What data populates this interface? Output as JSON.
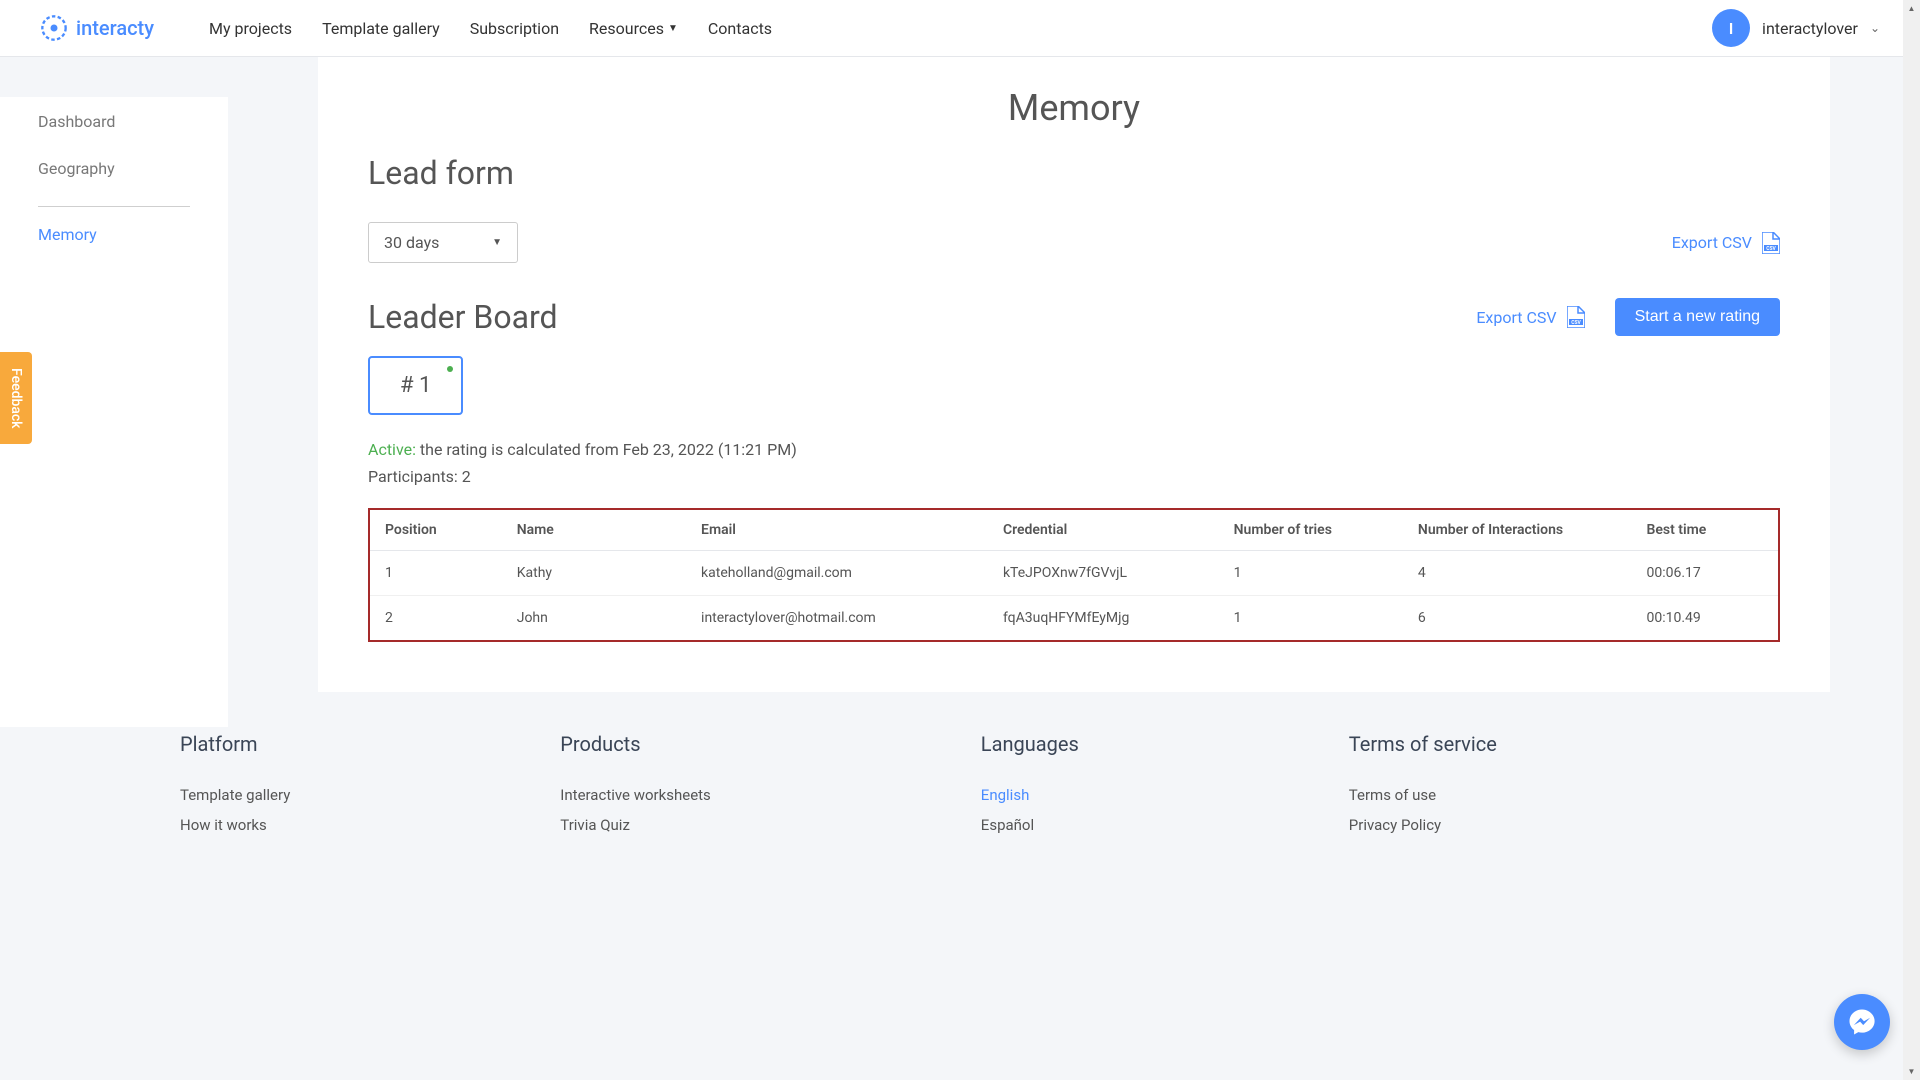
{
  "header": {
    "logo_text": "interacty",
    "nav": {
      "my_projects": "My projects",
      "template_gallery": "Template gallery",
      "subscription": "Subscription",
      "resources": "Resources",
      "contacts": "Contacts"
    },
    "user": {
      "initial": "I",
      "name": "interactylover"
    }
  },
  "sidebar": {
    "dashboard": "Dashboard",
    "geography": "Geography",
    "memory": "Memory"
  },
  "main": {
    "page_title": "Memory",
    "lead_form": {
      "title": "Lead form",
      "date_range": "30 days",
      "export_csv": "Export CSV"
    },
    "leaderboard": {
      "title": "Leader Board",
      "export_csv": "Export CSV",
      "start_new_rating": "Start a new rating",
      "rating_number": "# 1",
      "status_label": "Active:",
      "status_text": "the rating is calculated from Feb 23, 2022 (11:21 PM)",
      "participants": "Participants: 2",
      "table": {
        "headers": {
          "position": "Position",
          "name": "Name",
          "email": "Email",
          "credential": "Credential",
          "tries": "Number of tries",
          "interactions": "Number of Interactions",
          "best_time": "Best time"
        },
        "rows": [
          {
            "position": "1",
            "name": "Kathy",
            "email": "kateholland@gmail.com",
            "credential": "kTeJPOXnw7fGVvjL",
            "tries": "1",
            "interactions": "4",
            "best_time": "00:06.17"
          },
          {
            "position": "2",
            "name": "John",
            "email": "interactylover@hotmail.com",
            "credential": "fqA3uqHFYMfEyMjg",
            "tries": "1",
            "interactions": "6",
            "best_time": "00:10.49"
          }
        ]
      }
    }
  },
  "footer": {
    "platform": {
      "title": "Platform",
      "template_gallery": "Template gallery",
      "how_it_works": "How it works"
    },
    "products": {
      "title": "Products",
      "interactive_worksheets": "Interactive worksheets",
      "trivia_quiz": "Trivia Quiz"
    },
    "languages": {
      "title": "Languages",
      "english": "English",
      "espanol": "Español"
    },
    "terms": {
      "title": "Terms of service",
      "terms_of_use": "Terms of use",
      "privacy_policy": "Privacy Policy"
    }
  },
  "feedback_tab": "Feedback"
}
